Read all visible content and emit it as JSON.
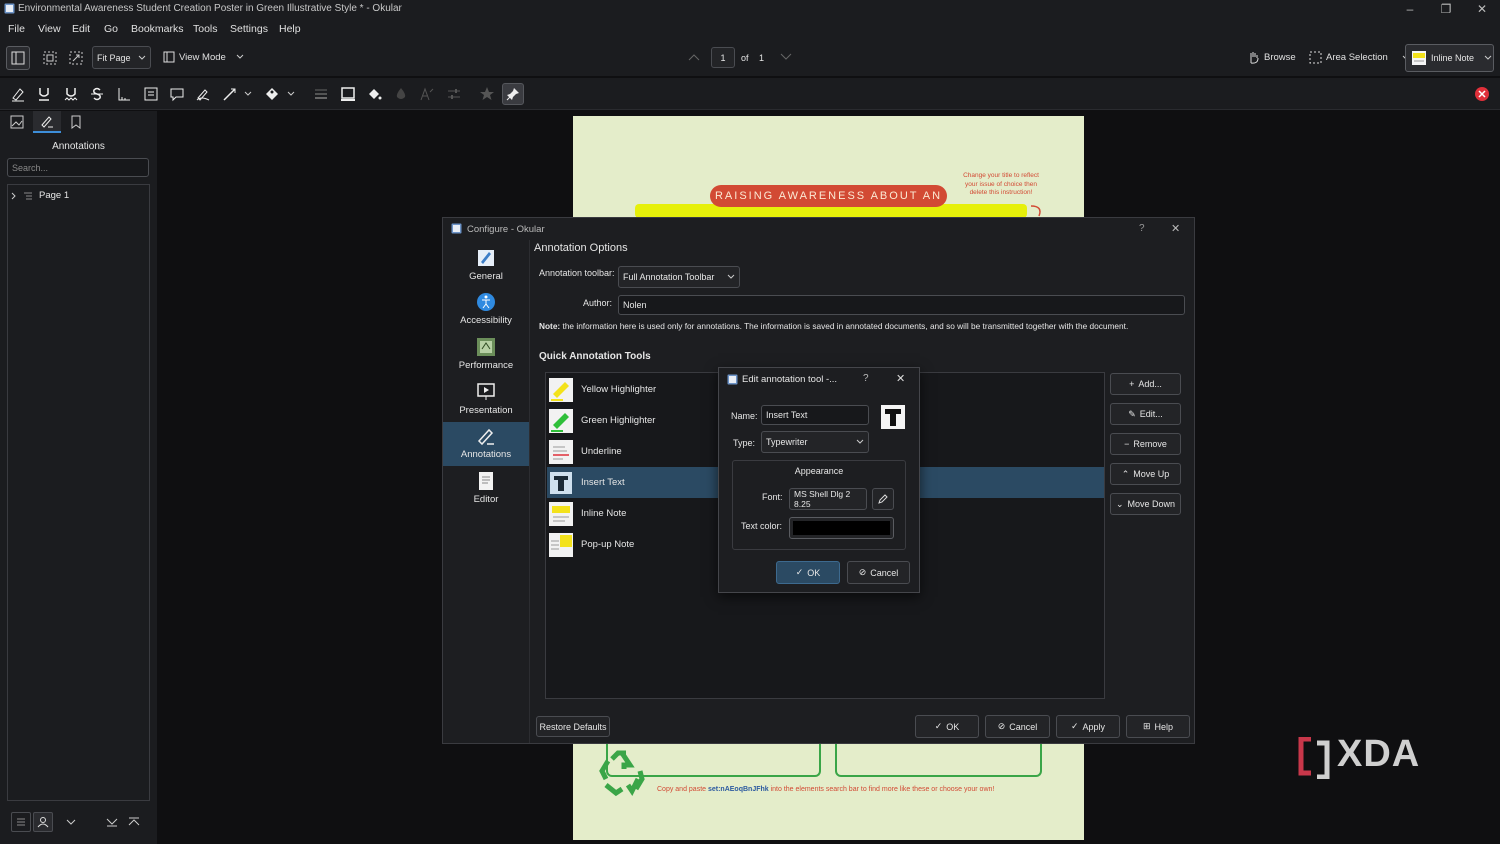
{
  "window": {
    "title": "Environmental Awareness Student Creation Poster in Green Illustrative Style * - Okular"
  },
  "menu": [
    "File",
    "View",
    "Edit",
    "Go",
    "Bookmarks",
    "Tools",
    "Settings",
    "Help"
  ],
  "toolbar": {
    "zoom": "Fit Page",
    "view_mode": "View Mode",
    "page_current": "1",
    "page_of": "of",
    "page_total": "1",
    "browse": "Browse",
    "area_selection": "Area Selection",
    "inline_note": "Inline Note"
  },
  "left_panel": {
    "title": "Annotations",
    "search_placeholder": "Search...",
    "tree_item": "Page 1"
  },
  "document": {
    "banner": "RAISING AWARENESS ABOUT AN",
    "note": "Change your title to reflect your issue of choice then delete this instruction!",
    "footer_pre": "Copy and paste ",
    "footer_code": "set:nAEoqBnJFhk",
    "footer_post": " into the elements search bar to find more like these or choose your own!"
  },
  "configure": {
    "title": "Configure - Okular",
    "help": "?",
    "sidebar": [
      "General",
      "Accessibility",
      "Performance",
      "Presentation",
      "Annotations",
      "Editor"
    ],
    "heading": "Annotation Options",
    "toolbar_label": "Annotation toolbar:",
    "toolbar_value": "Full Annotation Toolbar",
    "author_label": "Author:",
    "author_value": "Nolen",
    "note_bold": "Note:",
    "note_text": " the information here is used only for annotations. The information is saved in annotated documents, and so will be transmitted together with the document.",
    "quick_tools_heading": "Quick Annotation Tools",
    "tools": [
      "Yellow Highlighter",
      "Green Highlighter",
      "Underline",
      "Insert Text",
      "Inline Note",
      "Pop-up Note"
    ],
    "side_buttons": [
      "Add...",
      "Edit...",
      "Remove",
      "Move Up",
      "Move Down"
    ],
    "restore_defaults": "Restore Defaults",
    "bottom_buttons": [
      "OK",
      "Cancel",
      "Apply",
      "Help"
    ]
  },
  "edit_tool": {
    "title": "Edit annotation tool -...",
    "help": "?",
    "name_label": "Name:",
    "name_value": "Insert Text",
    "type_label": "Type:",
    "type_value": "Typewriter",
    "appearance": "Appearance",
    "font_label": "Font:",
    "font_value": "MS Shell Dlg 2 8.25",
    "text_color_label": "Text color:",
    "text_color": "#000000",
    "ok": "OK",
    "cancel": "Cancel"
  },
  "watermark": "XDA",
  "colors": {
    "accent": "#2b4a63",
    "page_bg": "#e4edca",
    "banner": "#d24a34",
    "highlight": "#e6f00a",
    "recycle": "#3aa547",
    "close_red": "#e0303a"
  }
}
